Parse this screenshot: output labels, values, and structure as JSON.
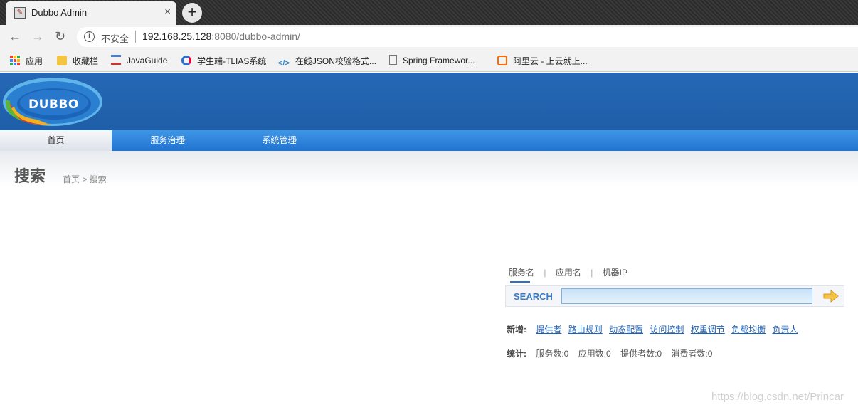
{
  "browser": {
    "tab_title": "Dubbo Admin",
    "tab_close": "×",
    "new_tab": "+",
    "insecure_label": "不安全",
    "url_host": "192.168.25.128",
    "url_rest": ":8080/dubbo-admin/",
    "bookmarks": [
      {
        "label": "应用",
        "icon": "apps-grid-icon"
      },
      {
        "label": "收藏栏",
        "icon": "folder-icon"
      },
      {
        "label": "JavaGuide",
        "icon": "page-icon"
      },
      {
        "label": "学生端-TLIAS系统",
        "icon": "site-icon"
      },
      {
        "label": "在线JSON校验格式...",
        "icon": "code-icon"
      },
      {
        "label": "Spring Framewor...",
        "icon": "document-icon"
      },
      {
        "label": "阿里云 - 上云就上...",
        "icon": "aliyun-icon"
      }
    ]
  },
  "app": {
    "logo_text": "DUBBO",
    "nav": [
      {
        "label": "首页",
        "active": true
      },
      {
        "label": "服务治理",
        "has_dropdown": true
      },
      {
        "label": "系统管理",
        "has_dropdown": true
      }
    ],
    "page_title": "搜索",
    "breadcrumb": "首页 > 搜索"
  },
  "search": {
    "tabs": [
      "服务名",
      "应用名",
      "机器IP"
    ],
    "active_tab": 0,
    "label": "SEARCH",
    "value": "",
    "add_label": "新增:",
    "add_links": [
      "提供者",
      "路由规则",
      "动态配置",
      "访问控制",
      "权重调节",
      "负载均衡",
      "负责人"
    ],
    "stats_label": "统计:",
    "stats": [
      "服务数:0",
      "应用数:0",
      "提供者数:0",
      "消费者数:0"
    ]
  },
  "watermark": "https://blog.csdn.net/Princar",
  "colors": {
    "header_blue": "#2266b3",
    "nav_blue": "#2c82da",
    "link": "#1e60b4"
  }
}
